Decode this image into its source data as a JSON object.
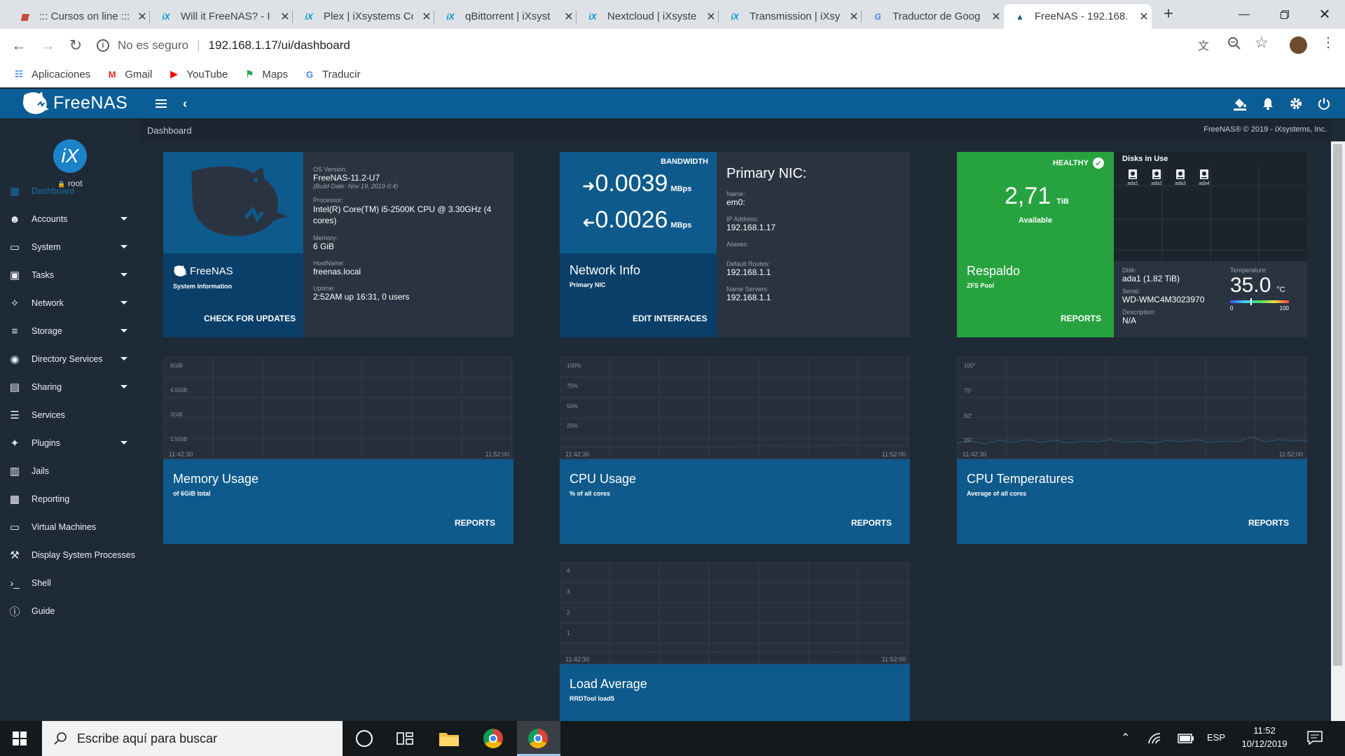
{
  "browser": {
    "tabs": [
      {
        "title": "::: Cursos on line :::",
        "icon": "grid-icon",
        "icon_color": "#c53929"
      },
      {
        "title": "Will it FreeNAS? - I",
        "icon": "ix-icon",
        "icon_color": "#0095d5"
      },
      {
        "title": "Plex | iXsystems Co",
        "icon": "ix-icon",
        "icon_color": "#0095d5"
      },
      {
        "title": "qBittorrent | iXsyst",
        "icon": "ix-icon",
        "icon_color": "#0095d5"
      },
      {
        "title": "Nextcloud | iXsyste",
        "icon": "ix-icon",
        "icon_color": "#0095d5"
      },
      {
        "title": "Transmission | iXsy",
        "icon": "ix-icon",
        "icon_color": "#0095d5"
      },
      {
        "title": "Traductor de Goog",
        "icon": "translate-icon",
        "icon_color": "#4285f4"
      },
      {
        "title": "FreeNAS - 192.168.",
        "icon": "freenas-icon",
        "icon_color": "#0a5e95",
        "active": true
      }
    ],
    "security_label": "No es seguro",
    "url": "192.168.1.17/ui/dashboard",
    "bookmarks": [
      {
        "label": "Aplicaciones",
        "icon": "apps-grid-icon"
      },
      {
        "label": "Gmail",
        "icon": "gmail-icon"
      },
      {
        "label": "YouTube",
        "icon": "youtube-icon"
      },
      {
        "label": "Maps",
        "icon": "maps-icon"
      },
      {
        "label": "Traducir",
        "icon": "translate-icon"
      }
    ]
  },
  "header": {
    "logo_text": "FreeNAS",
    "breadcrumb": "Dashboard",
    "copyright": "FreeNAS® © 2019 - iXsystems, Inc."
  },
  "sidebar": {
    "avatar_text": "iX",
    "user": "root",
    "items": [
      {
        "label": "Dashboard",
        "icon": "dashboard-icon",
        "active": true,
        "caret": false
      },
      {
        "label": "Accounts",
        "icon": "accounts-icon",
        "caret": true
      },
      {
        "label": "System",
        "icon": "laptop-icon",
        "caret": true
      },
      {
        "label": "Tasks",
        "icon": "calendar-icon",
        "caret": true
      },
      {
        "label": "Network",
        "icon": "network-icon",
        "caret": true
      },
      {
        "label": "Storage",
        "icon": "storage-icon",
        "caret": true
      },
      {
        "label": "Directory Services",
        "icon": "directory-icon",
        "caret": true
      },
      {
        "label": "Sharing",
        "icon": "folder-share-icon",
        "caret": true
      },
      {
        "label": "Services",
        "icon": "tune-icon",
        "caret": false
      },
      {
        "label": "Plugins",
        "icon": "puzzle-icon",
        "caret": true
      },
      {
        "label": "Jails",
        "icon": "jail-icon",
        "caret": false
      },
      {
        "label": "Reporting",
        "icon": "chart-icon",
        "caret": false
      },
      {
        "label": "Virtual Machines",
        "icon": "laptop-icon",
        "caret": false
      },
      {
        "label": "Display System Processes",
        "icon": "processes-icon",
        "caret": false
      },
      {
        "label": "Shell",
        "icon": "shell-icon",
        "caret": false
      },
      {
        "label": "Guide",
        "icon": "info-icon",
        "caret": false
      }
    ]
  },
  "sysinfo": {
    "brand": "FreeNAS",
    "subtitle": "System Information",
    "action": "CHECK FOR UPDATES",
    "os_label": "OS Version:",
    "os": "FreeNAS-11.2-U7",
    "build": "(Build Date: Nov 19, 2019 0:4)",
    "cpu_label": "Processor:",
    "cpu": "Intel(R) Core(TM) i5-2500K CPU @ 3.30GHz (4 cores)",
    "mem_label": "Memory:",
    "mem": "6 GiB",
    "host_label": "HostName:",
    "host": "freenas.local",
    "uptime_label": "Uptime:",
    "uptime": "2:52AM up 16:31, 0 users"
  },
  "network": {
    "bandwidth_label": "BANDWIDTH",
    "in_value": "0.0039",
    "out_value": "0.0026",
    "unit": "MBps",
    "title": "Network Info",
    "subtitle": "Primary NIC",
    "action": "EDIT INTERFACES",
    "nic_title": "Primary NIC:",
    "name_label": "Name:",
    "name": "em0:",
    "ip_label": "IP Address:",
    "ip": "192.168.1.17",
    "aliases_label": "Aliases:",
    "routes_label": "Default Routes:",
    "routes": "192.168.1.1",
    "dns_label": "Name Servers:",
    "dns": "192.168.1.1"
  },
  "pool": {
    "status": "HEALTHY",
    "available_value": "2,71",
    "available_unit": "TiB",
    "available_label": "Available",
    "name": "Respaldo",
    "type": "ZFS Pool",
    "action": "REPORTS",
    "disks_title": "Disks in Use",
    "disks": [
      "ada1",
      "ada2",
      "ada3",
      "ada4"
    ],
    "disk_label": "Disk:",
    "disk": "ada1 (1.82 TiB)",
    "serial_label": "Serial:",
    "serial": "WD-WMC4M3023970",
    "desc_label": "Description:",
    "desc": "N/A",
    "temp_label": "Temperature:",
    "temp_value": "35.0",
    "temp_unit": "°C",
    "temp_min": "0",
    "temp_max": "100",
    "temp_level": 0.35
  },
  "widgets": {
    "memory": {
      "title": "Memory Usage",
      "subtitle": "of 6GiB total",
      "action": "REPORTS",
      "yticks": [
        "6GiB",
        "4.5GiB",
        "3GiB",
        "1.5GiB"
      ],
      "x_start": "11:42:30",
      "x_end": "11:52:00"
    },
    "cpu": {
      "title": "CPU Usage",
      "subtitle": "% of all cores",
      "action": "REPORTS",
      "yticks": [
        "100%",
        "75%",
        "50%",
        "25%"
      ],
      "x_start": "11:42:30",
      "x_end": "11:52:00"
    },
    "temps": {
      "title": "CPU Temperatures",
      "subtitle": "Average of all cores",
      "action": "REPORTS",
      "yticks": [
        "100°",
        "75°",
        "50°",
        "25°"
      ],
      "x_start": "11:42:30",
      "x_end": "11:52:00"
    },
    "load": {
      "title": "Load Average",
      "subtitle": "RRDTool load5",
      "yticks": [
        "4",
        "3",
        "2",
        "1"
      ],
      "x_start": "11:42:30",
      "x_end": "11:52:00"
    }
  },
  "taskbar": {
    "search_placeholder": "Escribe aquí para buscar",
    "lang": "ESP",
    "time": "11:52",
    "date": "10/12/2019"
  }
}
